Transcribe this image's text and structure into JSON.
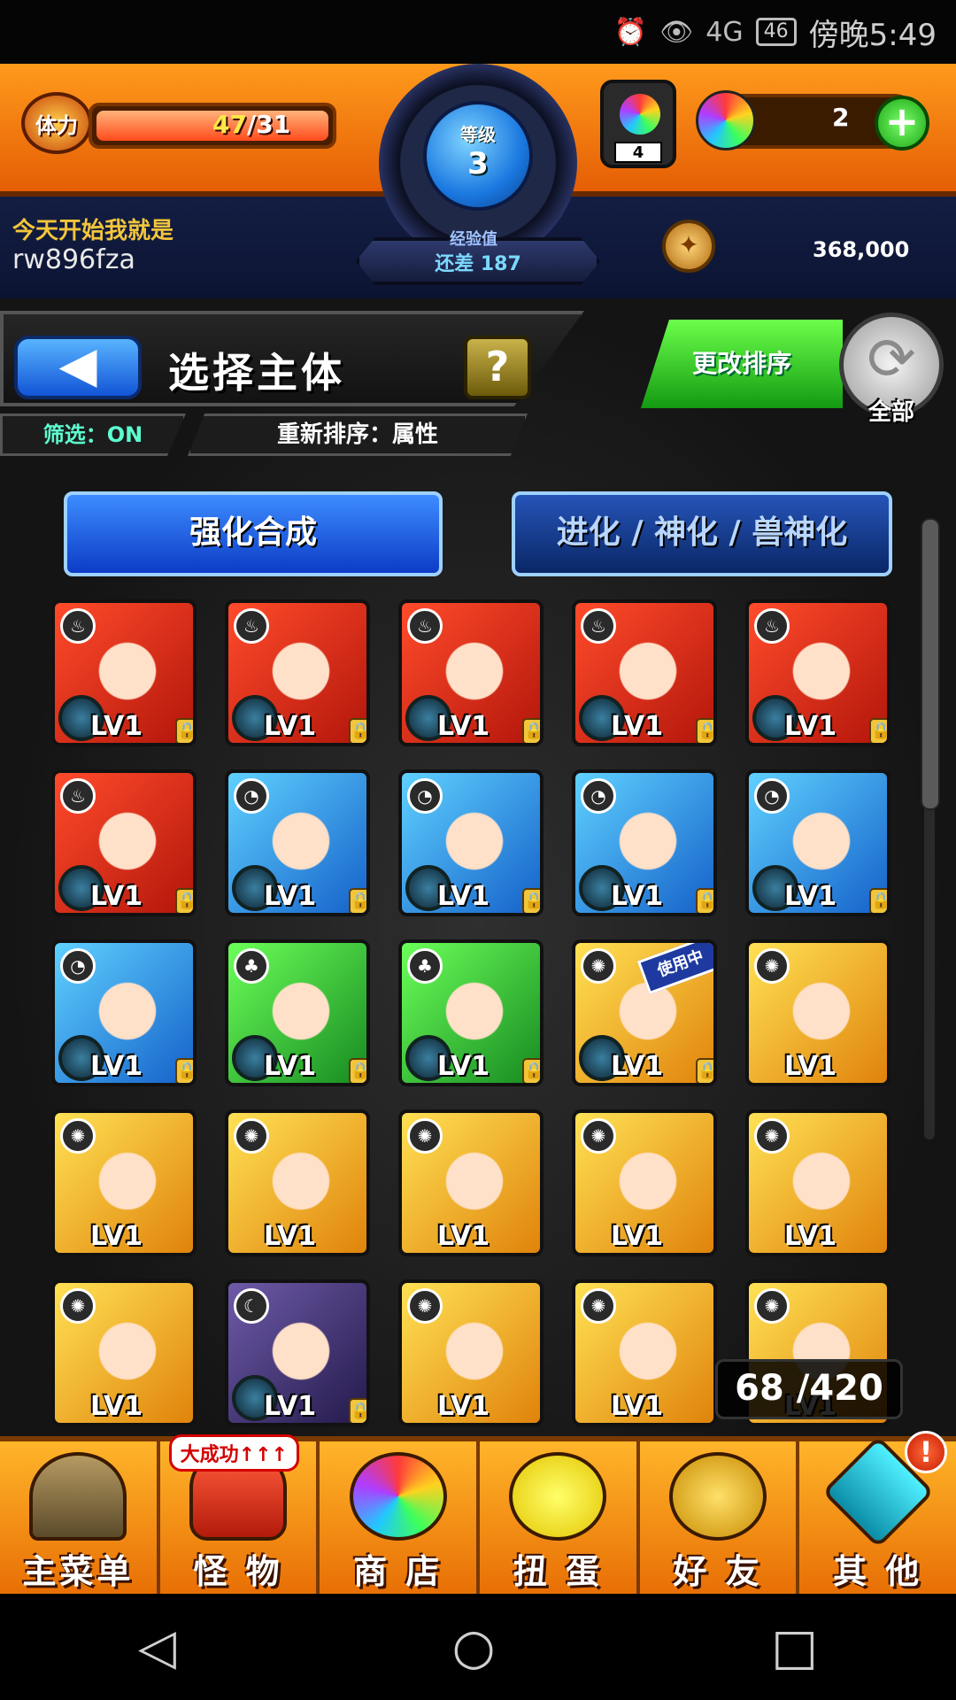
{
  "status_bar": {
    "alarm_icon": "alarm-clock-icon",
    "eye_icon": "eye-icon",
    "network": "4G",
    "battery": "46",
    "time": "傍晚5:49"
  },
  "header": {
    "stamina_label": "体力",
    "stamina_current": "47",
    "stamina_max": "/31",
    "level_label": "等级",
    "level_value": "3",
    "orb_count": "4",
    "gem_count": "2",
    "gem_add": "+",
    "motto": "今天开始我就是",
    "username": "rw896fza",
    "exp_label": "经验值",
    "exp_remain": "还差 187",
    "coin_count": "368,000"
  },
  "toolbar": {
    "back_glyph": "◀",
    "title": "选择主体",
    "help": "?",
    "filter": "筛选：ON",
    "sort_current": "重新排序：属性",
    "change_sort": "更改排序",
    "all_label": "全部",
    "all_glyph": "⟳"
  },
  "tabs": {
    "enhance": "强化合成",
    "evolve": "进化 / 神化 / 兽神化"
  },
  "monsters": [
    {
      "attr": "fire",
      "level": "LV1",
      "locked": true
    },
    {
      "attr": "fire",
      "level": "LV1",
      "locked": true
    },
    {
      "attr": "fire",
      "level": "LV1",
      "locked": true
    },
    {
      "attr": "fire",
      "level": "LV1",
      "locked": true
    },
    {
      "attr": "fire",
      "level": "LV1",
      "locked": true
    },
    {
      "attr": "fire",
      "level": "LV1",
      "locked": true
    },
    {
      "attr": "water",
      "level": "LV1",
      "locked": true
    },
    {
      "attr": "water",
      "level": "LV1",
      "locked": true
    },
    {
      "attr": "water",
      "level": "LV1",
      "locked": true
    },
    {
      "attr": "water",
      "level": "LV1",
      "locked": true
    },
    {
      "attr": "water",
      "level": "LV1",
      "locked": true
    },
    {
      "attr": "wood",
      "level": "LV1",
      "locked": true
    },
    {
      "attr": "wood",
      "level": "LV1",
      "locked": true
    },
    {
      "attr": "light",
      "level": "LV1",
      "locked": true,
      "in_use": "使用中"
    },
    {
      "attr": "light",
      "level": "LV1",
      "locked": false
    },
    {
      "attr": "light",
      "level": "LV1",
      "locked": false
    },
    {
      "attr": "light",
      "level": "LV1",
      "locked": false
    },
    {
      "attr": "light",
      "level": "LV1",
      "locked": false
    },
    {
      "attr": "light",
      "level": "LV1",
      "locked": false
    },
    {
      "attr": "light",
      "level": "LV1",
      "locked": false
    },
    {
      "attr": "light",
      "level": "LV1",
      "locked": false
    },
    {
      "attr": "dark",
      "level": "LV1",
      "locked": true
    },
    {
      "attr": "light",
      "level": "LV1",
      "locked": false
    },
    {
      "attr": "light",
      "level": "LV1",
      "locked": false
    },
    {
      "attr": "light",
      "level": "LV1",
      "locked": false
    }
  ],
  "box_count": "68 /420",
  "menu": [
    {
      "label": "主菜单",
      "icon": "home-gate-icon",
      "cls": "i-home"
    },
    {
      "label": "怪 物",
      "icon": "monster-icon",
      "cls": "i-monster",
      "badge": "大成功↑↑↑"
    },
    {
      "label": "商 店",
      "icon": "rainbow-orb-icon",
      "cls": "i-shop"
    },
    {
      "label": "扭 蛋",
      "icon": "egg-icon",
      "cls": "i-gacha"
    },
    {
      "label": "好 友",
      "icon": "friends-icon",
      "cls": "i-friend"
    },
    {
      "label": "其 他",
      "icon": "other-icon",
      "cls": "i-other",
      "alert": "!"
    }
  ],
  "navbar": {
    "back": "◁",
    "home": "○",
    "recents": "□"
  },
  "colors": {
    "header_orange": "#ff9a1c",
    "header_navy": "#1d2b57",
    "tab_blue": "#3d8cff",
    "sort_green": "#6bff4a",
    "filter_text": "#5cffd0"
  }
}
